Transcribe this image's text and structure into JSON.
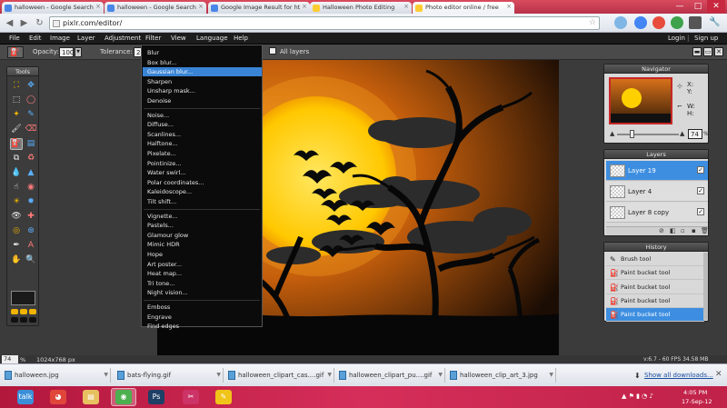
{
  "browser": {
    "tabs": [
      {
        "title": "halloween - Google Search",
        "color": "#4a86e8"
      },
      {
        "title": "halloween - Google Search",
        "color": "#4a86e8"
      },
      {
        "title": "Google Image Result for ht",
        "color": "#4a86e8"
      },
      {
        "title": "Halloween Photo Editing",
        "color": "#ffcc33"
      },
      {
        "title": "Photo editor online / free",
        "color": "#ffcc33"
      }
    ],
    "tab_close": "×",
    "url": "pixlr.com/editor/",
    "window_buttons": {
      "minimize": "—",
      "maximize": "□",
      "close": "✕"
    }
  },
  "menubar": {
    "items": [
      "File",
      "Edit",
      "Image",
      "Layer",
      "Adjustment",
      "Filter",
      "View",
      "Language",
      "Help"
    ],
    "login": "Login",
    "separator": "|",
    "signup": "Sign up"
  },
  "options": {
    "opacity_label": "Opacity:",
    "opacity_value": "100",
    "tolerance_label": "Tolerance:",
    "tolerance_value": "2",
    "all_layers": "All layers"
  },
  "tools": {
    "title": "Tools"
  },
  "filter_menu": {
    "groups": [
      [
        "Blur",
        "Box blur...",
        "Gaussian blur...",
        "Sharpen",
        "Unsharp mask...",
        "Denoise"
      ],
      [
        "Noise...",
        "Diffuse...",
        "Scanlines...",
        "Halftone...",
        "Pixelate...",
        "Pointinize...",
        "Water swirl...",
        "Polar coordinates...",
        "Kaleidoscope...",
        "Tilt shift..."
      ],
      [
        "Vignette...",
        "Pastels...",
        "Glamour glow",
        "Mimic HDR",
        "Hope",
        "Art poster...",
        "Heat map...",
        "Tri tone...",
        "Night vision..."
      ],
      [
        "Emboss",
        "Engrave",
        "Find edges"
      ]
    ],
    "highlighted": "Gaussian blur..."
  },
  "navigator": {
    "title": "Navigator",
    "x_label": "X:",
    "y_label": "Y:",
    "w_label": "W:",
    "h_label": "H:",
    "zoom_value": "74",
    "zoom_unit": "%"
  },
  "layers": {
    "title": "Layers",
    "items": [
      {
        "name": "Layer 19",
        "selected": true
      },
      {
        "name": "Layer 4",
        "selected": false
      },
      {
        "name": "Layer 8 copy",
        "selected": false
      }
    ],
    "check": "✓"
  },
  "history": {
    "title": "History",
    "items": [
      {
        "label": "Brush tool",
        "selected": false
      },
      {
        "label": "Paint bucket tool",
        "selected": false
      },
      {
        "label": "Paint bucket tool",
        "selected": false
      },
      {
        "label": "Paint bucket tool",
        "selected": false
      },
      {
        "label": "Paint bucket tool",
        "selected": true
      }
    ]
  },
  "status": {
    "zoom": "74",
    "zoom_unit": "%",
    "dimensions": "1024x768 px",
    "version": "v:6.7 - 60 FPS 34.58 MB"
  },
  "downloads": {
    "items": [
      "halloween.jpg",
      "bats-flying.gif",
      "halloween_clipart_cas....gif",
      "halloween_clipart_pu....gif",
      "halloween_clip_art_3.jpg"
    ],
    "show_all": "Show all downloads..."
  },
  "taskbar": {
    "apps": [
      {
        "name": "talk",
        "glyph": "talk",
        "color": "#3b8fd8"
      },
      {
        "name": "picasa",
        "glyph": "◕",
        "color": "#e0473a"
      },
      {
        "name": "explorer",
        "glyph": "▤",
        "color": "#e8c060"
      },
      {
        "name": "chrome",
        "glyph": "◉",
        "color": "#4caf50"
      },
      {
        "name": "photoshop",
        "glyph": "Ps",
        "color": "#1e3f66"
      },
      {
        "name": "tool",
        "glyph": "✂",
        "color": "#cc3366"
      },
      {
        "name": "paint",
        "glyph": "✎",
        "color": "#f0c419"
      }
    ],
    "time": "4:05 PM",
    "date": "17-Sep-12"
  },
  "colors": {
    "accent": "#3d8ee0",
    "moon": "#ffd400",
    "sky": "#e07a10",
    "taskbar": "#c02248"
  }
}
